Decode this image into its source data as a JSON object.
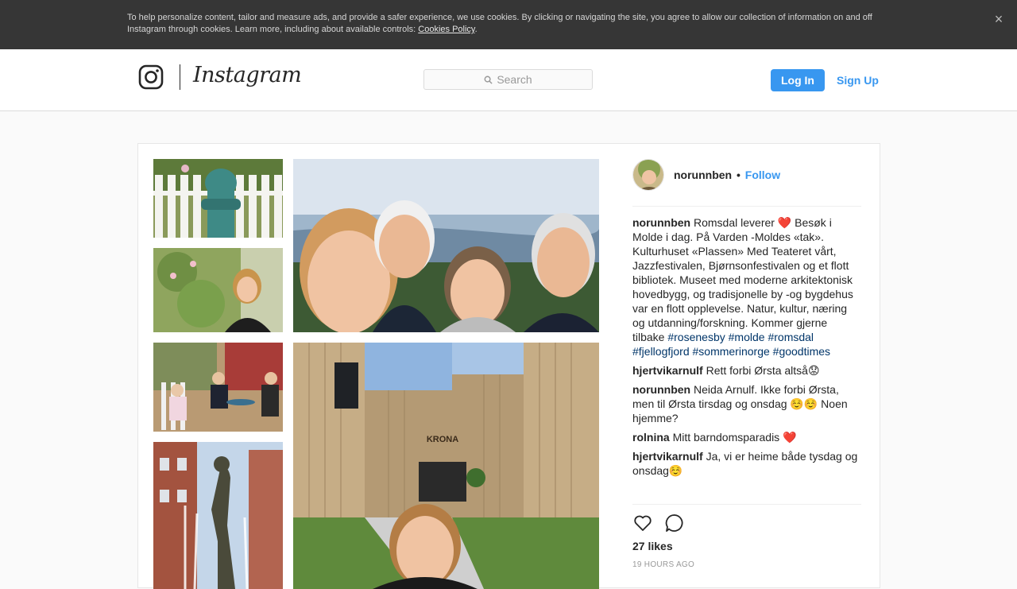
{
  "cookie_banner": {
    "text": "To help personalize content, tailor and measure ads, and provide a safer experience, we use cookies. By clicking or navigating the site, you agree to allow our collection of information on and off Instagram through cookies. Learn more, including about available controls: ",
    "link": "Cookies Policy",
    "suffix": ".",
    "close": "×"
  },
  "header": {
    "wordmark": "Instagram",
    "search_placeholder": "Search",
    "login": "Log In",
    "signup": "Sign Up"
  },
  "post": {
    "username": "norunnben",
    "dot": "•",
    "follow": "Follow",
    "caption": {
      "user": "norunnben",
      "text": "Romsdal leverer ❤️ Besøk i Molde i dag. På Varden -Moldes «tak». Kulturhuset «Plassen» Med Teateret vårt, Jazzfestivalen, Bjørnsonfestivalen og et flott bibliotek. Museet med moderne arkitektonisk hovedbygg, og tradisjonelle by -og bygdehus var en flott opplevelse. Natur, kultur, næring og utdanning/forskning. Kommer gjerne tilbake ",
      "tags": [
        "#rosenesby",
        "#molde",
        "#romsdal",
        "#fjellogfjord",
        "#sommerinorge",
        "#goodtimes"
      ]
    },
    "comments": [
      {
        "user": "hjertvikarnulf",
        "text": "Rett forbi Ørsta altså😟"
      },
      {
        "user": "norunnben",
        "text": "Neida Arnulf. Ikke forbi Ørsta, men til Ørsta tirsdag og onsdag ☺️☺️ Noen hjemme?"
      },
      {
        "user": "rolnina",
        "text": "Mitt barndomsparadis ❤️"
      },
      {
        "user": "hjertvikarnulf",
        "text": "Ja, vi er heime både tysdag og onsdag☺️"
      }
    ],
    "likes": "27 likes",
    "time": "19 HOURS AGO",
    "photo_sign_text": "KRONA"
  },
  "colors": {
    "accent": "#3897f0",
    "hashtag": "#003569",
    "banner_bg": "#363636"
  },
  "icons": {
    "instagram_logo": "instagram-glyph-icon",
    "search": "search-icon",
    "close": "close-icon",
    "like": "heart-icon",
    "comment": "comment-bubble-icon"
  }
}
